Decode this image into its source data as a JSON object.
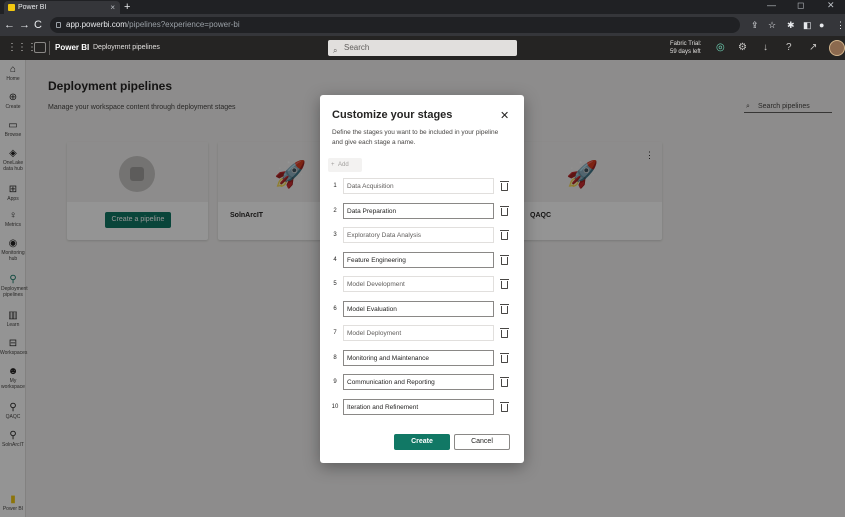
{
  "browser": {
    "tab_title": "Power BI",
    "tab_close": "×",
    "new_tab": "+",
    "url_host": "app.powerbi.com",
    "url_path": "/pipelines?experience=power-bi",
    "back": "←",
    "forward": "→",
    "reload": "C",
    "window_minimize": "—",
    "window_maximize": "◻",
    "window_close": "✕",
    "extensions": [
      "⇪",
      "☆",
      "✱",
      "◧",
      "●",
      "⋮"
    ]
  },
  "header": {
    "waffle": "⋮⋮⋮",
    "brand": "Power BI",
    "breadcrumb": "Deployment pipelines",
    "search_placeholder": "Search",
    "search_icon": "⌕",
    "trial_line1": "Fabric Trial:",
    "trial_line2": "59 days left",
    "icons": [
      "◎",
      "⚙",
      "↓",
      "?",
      "↗"
    ]
  },
  "leftnav": {
    "items": [
      {
        "icon": "⌂",
        "label": "Home"
      },
      {
        "icon": "⊕",
        "label": "Create"
      },
      {
        "icon": "▭",
        "label": "Browse"
      },
      {
        "icon": "◈",
        "label": "OneLake data hub"
      },
      {
        "icon": "⊞",
        "label": "Apps"
      },
      {
        "icon": "♀",
        "label": "Metrics"
      },
      {
        "icon": "◉",
        "label": "Monitoring hub"
      },
      {
        "icon": "⚲",
        "label": "Deployment pipelines"
      },
      {
        "icon": "▥",
        "label": "Learn"
      },
      {
        "icon": "⊟",
        "label": "Workspaces"
      },
      {
        "icon": "☻",
        "label": "My workspace"
      },
      {
        "icon": "⚲",
        "label": "QAQC"
      },
      {
        "icon": "⚲",
        "label": "SolnArcIT"
      },
      {
        "icon": "▮",
        "label": "Power BI"
      }
    ]
  },
  "page": {
    "title": "Deployment pipelines",
    "subtitle": "Manage your workspace content through deployment stages",
    "search_pipelines": "Search pipelines",
    "search_icon": "⌕",
    "create_pipeline": "Create a pipeline",
    "cards": [
      {
        "name": "SolnArcIT"
      },
      {
        "name": "QAQC"
      }
    ],
    "rocket": "🚀",
    "more": "⋮"
  },
  "modal": {
    "title": "Customize your stages",
    "close": "✕",
    "description": "Define the stages you want to be included in your pipeline and give each stage a name.",
    "add_label": "Add",
    "add_icon": "+",
    "stages": [
      {
        "num": "1",
        "name": "Data Acquisition"
      },
      {
        "num": "2",
        "name": "Data Preparation"
      },
      {
        "num": "3",
        "name": "Exploratory Data Analysis"
      },
      {
        "num": "4",
        "name": "Feature Engineering"
      },
      {
        "num": "5",
        "name": "Model Development"
      },
      {
        "num": "6",
        "name": "Model Evaluation"
      },
      {
        "num": "7",
        "name": "Model Deployment"
      },
      {
        "num": "8",
        "name": "Monitoring and Maintenance"
      },
      {
        "num": "9",
        "name": "Communication and Reporting"
      },
      {
        "num": "10",
        "name": "Iteration and Refinement"
      }
    ],
    "create_label": "Create",
    "cancel_label": "Cancel"
  },
  "colors": {
    "accent": "#117865",
    "header_bg": "#252423",
    "chrome_bg": "#202124"
  }
}
